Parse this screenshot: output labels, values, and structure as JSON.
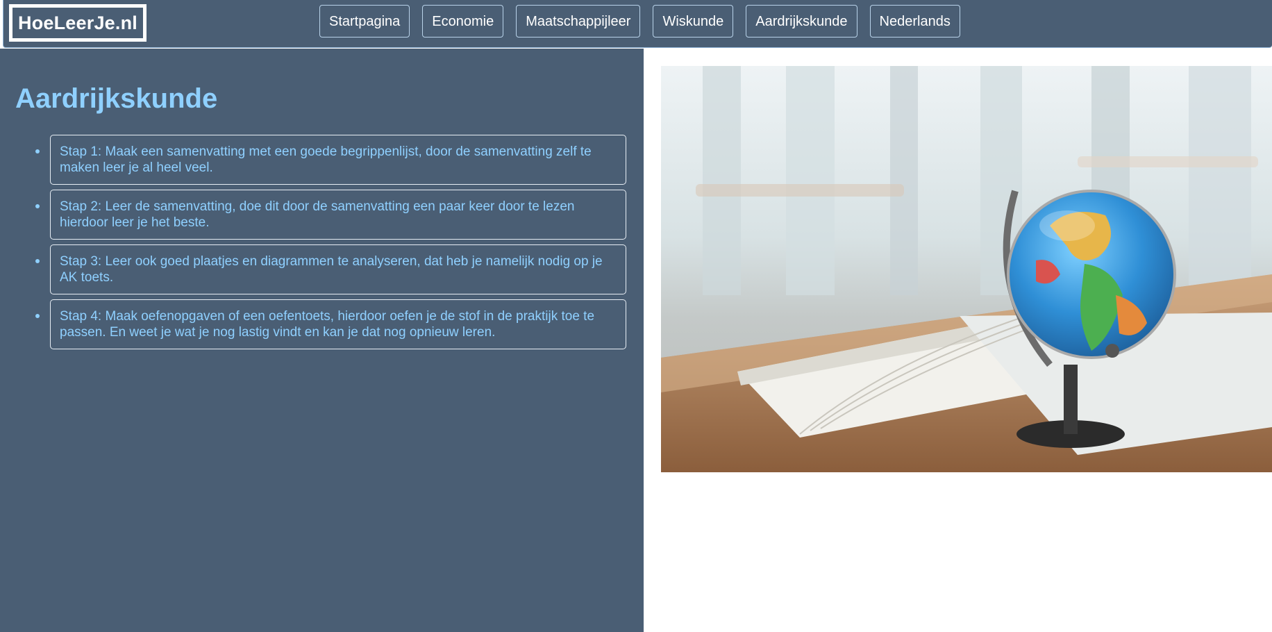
{
  "header": {
    "logo": "HoeLeerJe.nl",
    "nav": [
      "Startpagina",
      "Economie",
      "Maatschappijleer",
      "Wiskunde",
      "Aardrijkskunde",
      "Nederlands"
    ]
  },
  "main": {
    "title": "Aardrijkskunde",
    "steps": [
      "Stap 1: Maak een samenvatting met een goede begrippenlijst, door de samenvatting zelf te maken leer je al heel veel.",
      "Stap 2: Leer de samenvatting, doe dit door de samenvatting een paar keer door te lezen hierdoor leer je het beste.",
      "Stap 3: Leer ook goed plaatjes en diagrammen te analyseren, dat heb je namelijk nodig op je AK toets.",
      "Stap 4: Maak oefenopgaven of een oefentoets, hierdoor oefen je de stof in de praktijk toe te passen. En weet je wat je nog lastig vindt en kan je dat nog opnieuw leren."
    ]
  },
  "image": {
    "icon": "globe-on-book-photo"
  },
  "colors": {
    "panel": "#4a5e74",
    "accent_text": "#8fd0ff",
    "border": "#ffffff"
  }
}
